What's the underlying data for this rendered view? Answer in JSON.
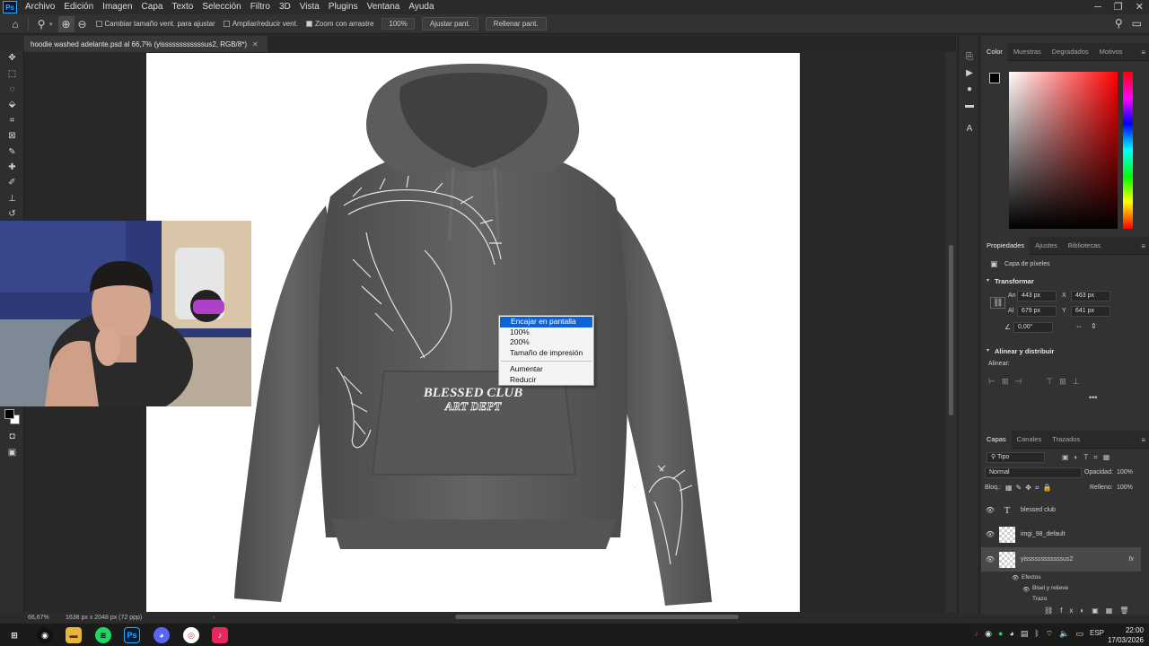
{
  "app": {
    "logo": "Ps",
    "menu": [
      "Archivo",
      "Edición",
      "Imagen",
      "Capa",
      "Texto",
      "Selección",
      "Filtro",
      "3D",
      "Vista",
      "Plugins",
      "Ventana",
      "Ayuda"
    ]
  },
  "options_bar": {
    "resize_windows": "Cambiar tamaño vent. para ajustar",
    "zoom_all_windows": "Ampliar/reducir vent.",
    "scrubby_zoom": "Zoom con arrastre",
    "zoom_value": "100%",
    "fit_screen": "Ajustar pant.",
    "fill_screen": "Rellenar pant."
  },
  "document": {
    "tab_title": "hoodie washed adelante.psd al 66,7% (yissssssssssssus2, RGB/8*)",
    "artwork": {
      "print_title": "BLESSED CLUB",
      "print_subtitle": "ART DEPT",
      "garment_color": "#5e5e5e",
      "print_color": "#f2f2f2"
    }
  },
  "context_menu": {
    "items": [
      "Encajar en pantalla",
      "100%",
      "200%",
      "Tamaño de impresión",
      "Aumentar",
      "Reducir"
    ],
    "highlighted": "Encajar en pantalla"
  },
  "status_bar": {
    "zoom": "66,67%",
    "doc_size": "1638 px x 2048 px (72 ppp)"
  },
  "color_panel": {
    "tabs": [
      "Color",
      "Muestras",
      "Degradados",
      "Motivos"
    ],
    "hue": "#ff0000"
  },
  "properties": {
    "tabs": [
      "Propiedades",
      "Ajustes",
      "Bibliotecas"
    ],
    "layer_type": "Capa de píxeles",
    "transform_title": "Transformar",
    "an_label": "An",
    "an_value": "443 px",
    "x_label": "X",
    "x_value": "463 px",
    "al_label": "Al",
    "al_value": "679 px",
    "y_label": "Y",
    "y_value": "641 px",
    "angle": "0,00°",
    "align_title": "Alinear y distribuir",
    "align_label": "Alinear:"
  },
  "layers": {
    "tabs": [
      "Capas",
      "Canales",
      "Trazados"
    ],
    "filter": "Tipo",
    "blend_mode": "Normal",
    "opacity_label": "Opacidad:",
    "opacity": "100%",
    "lock_label": "Bloq.:",
    "fill_label": "Relleno:",
    "fill": "100%",
    "items": [
      {
        "name": "blessed club",
        "type": "text"
      },
      {
        "name": "imgi_98_default",
        "type": "pixel"
      },
      {
        "name": "yissssssssssssus2",
        "type": "pixel",
        "fx": "fx"
      }
    ],
    "effects_label": "Efectos",
    "effects": [
      "Bisel y relieve",
      "Trazo"
    ]
  },
  "taskbar": {
    "lang": "ESP",
    "time": "22:00",
    "date": "17/03/2026"
  }
}
